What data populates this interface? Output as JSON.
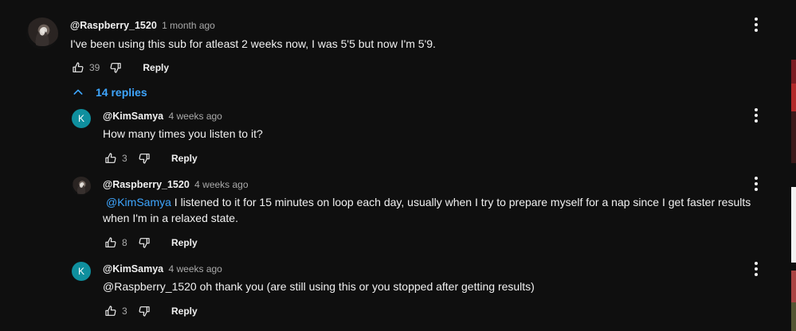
{
  "thread": {
    "top_comment": {
      "author": "@Raspberry_1520",
      "time": "1 month ago",
      "text": "I've been using this sub for atleast 2 weeks now, I was 5'5 but now I'm 5'9.",
      "likes": "39",
      "reply_label": "Reply"
    },
    "replies_toggle_label": "14 replies",
    "replies": [
      {
        "author": "@KimSamya",
        "time": "4 weeks ago",
        "avatar_letter": "K",
        "text": "How many times you listen to it?",
        "likes": "3",
        "reply_label": "Reply"
      },
      {
        "author": "@Raspberry_1520",
        "time": "4 weeks ago",
        "mention": "@KimSamya",
        "text_line1": " I listened to it for 15 minutes on loop each day, usually when I try to prepare myself for a nap since I get faster results",
        "text_line2": "when I'm in a relaxed state.",
        "likes": "8",
        "reply_label": "Reply"
      },
      {
        "author": "@KimSamya",
        "time": "4 weeks ago",
        "avatar_letter": "K",
        "text": "@Raspberry_1520 oh thank you (are still using this or you stopped after getting results)",
        "likes": "3",
        "reply_label": "Reply"
      }
    ]
  },
  "colors": {
    "background": "#0f0f0f",
    "text_primary": "#f1f1f1",
    "text_secondary": "#aaaaaa",
    "link_blue": "#3ea6ff",
    "avatar_teal": "#0f8f9e"
  },
  "icons": [
    "like-icon",
    "dislike-icon",
    "more-vert-icon",
    "chevron-up-icon"
  ]
}
